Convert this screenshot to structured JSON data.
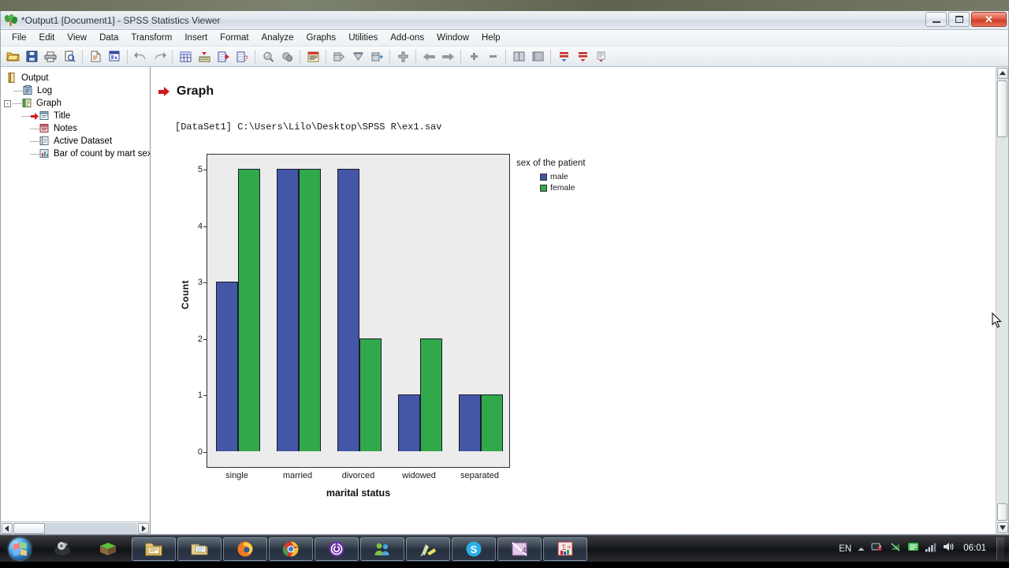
{
  "window": {
    "title": "*Output1 [Document1] - SPSS Statistics Viewer",
    "app_icon": "spss-leaf-icon",
    "minimize_label": "Minimize",
    "maximize_label": "Maximize",
    "close_label": "Close"
  },
  "menubar": {
    "items": [
      {
        "label": "File"
      },
      {
        "label": "Edit"
      },
      {
        "label": "View"
      },
      {
        "label": "Data"
      },
      {
        "label": "Transform"
      },
      {
        "label": "Insert"
      },
      {
        "label": "Format"
      },
      {
        "label": "Analyze"
      },
      {
        "label": "Graphs"
      },
      {
        "label": "Utilities"
      },
      {
        "label": "Add-ons"
      },
      {
        "label": "Window"
      },
      {
        "label": "Help"
      }
    ]
  },
  "toolbar": {
    "buttons": [
      {
        "name": "open-file-icon",
        "tooltip": "Open"
      },
      {
        "name": "save-icon",
        "tooltip": "Save"
      },
      {
        "name": "print-icon",
        "tooltip": "Print"
      },
      {
        "name": "print-preview-icon",
        "tooltip": "Print Preview"
      },
      {
        "name": "new-document-icon",
        "tooltip": "New"
      },
      {
        "name": "export-icon",
        "tooltip": "Export"
      },
      {
        "name": "undo-icon",
        "tooltip": "Undo"
      },
      {
        "name": "redo-icon",
        "tooltip": "Redo"
      },
      {
        "name": "goto-data-icon",
        "tooltip": "Go To Data"
      },
      {
        "name": "variables-icon",
        "tooltip": "Variables"
      },
      {
        "name": "goto-case-icon",
        "tooltip": "Go To Case"
      },
      {
        "name": "run-descriptives-icon",
        "tooltip": "Run Descriptives"
      },
      {
        "name": "find-icon",
        "tooltip": "Find"
      },
      {
        "name": "select-cases-icon",
        "tooltip": "Select Cases"
      },
      {
        "name": "insert-title-icon",
        "tooltip": "Insert Title"
      },
      {
        "name": "split-file-icon",
        "tooltip": "Split File"
      },
      {
        "name": "weight-cases-icon",
        "tooltip": "Weight Cases"
      },
      {
        "name": "value-labels-icon",
        "tooltip": "Value Labels"
      },
      {
        "name": "add-item-icon",
        "tooltip": "Insert"
      },
      {
        "name": "back-arrow-icon",
        "tooltip": "Back"
      },
      {
        "name": "forward-arrow-icon",
        "tooltip": "Forward"
      },
      {
        "name": "expand-icon",
        "tooltip": "Expand"
      },
      {
        "name": "collapse-icon",
        "tooltip": "Collapse"
      },
      {
        "name": "show-book-icon",
        "tooltip": "Show"
      },
      {
        "name": "hide-book-icon",
        "tooltip": "Hide"
      },
      {
        "name": "promote-icon",
        "tooltip": "Promote"
      },
      {
        "name": "demote-icon",
        "tooltip": "Demote"
      },
      {
        "name": "insert-note-icon",
        "tooltip": "Insert Note"
      }
    ]
  },
  "outline": {
    "root": {
      "label": "Output",
      "icon": "output-icon"
    },
    "items": [
      {
        "label": "Log",
        "icon": "log-icon",
        "depth": 1,
        "selected": false,
        "has_marker": false,
        "expander": null
      },
      {
        "label": "Graph",
        "icon": "graph-icon",
        "depth": 1,
        "selected": false,
        "has_marker": false,
        "expander": "-"
      },
      {
        "label": "Title",
        "icon": "title-icon",
        "depth": 2,
        "selected": false,
        "has_marker": true,
        "expander": null
      },
      {
        "label": "Notes",
        "icon": "notes-icon",
        "depth": 2,
        "selected": false,
        "has_marker": false,
        "expander": null
      },
      {
        "label": "Active Dataset",
        "icon": "dataset-icon",
        "depth": 2,
        "selected": false,
        "has_marker": false,
        "expander": null
      },
      {
        "label": "Bar of count by mart sex",
        "icon": "bar-chart-icon",
        "depth": 2,
        "selected": false,
        "has_marker": false,
        "expander": null
      }
    ]
  },
  "output": {
    "heading": "Graph",
    "heading_marker": "red-arrow-icon",
    "dataset_line": "[DataSet1] C:\\Users\\Lilo\\Desktop\\SPSS R\\ex1.sav"
  },
  "colors": {
    "male": "#4457a6",
    "female": "#31a94a",
    "plot_background": "#ececec",
    "plot_border": "#2f2f2f",
    "accent_red": "#d01a1a"
  },
  "chart_data": {
    "type": "bar",
    "title": "",
    "xlabel": "marital status",
    "ylabel": "Count",
    "categories": [
      "single",
      "married",
      "divorced",
      "widowed",
      "separated"
    ],
    "series": [
      {
        "name": "male",
        "color": "#4457a6",
        "values": [
          3,
          5,
          5,
          1,
          1
        ]
      },
      {
        "name": "female",
        "color": "#31a94a",
        "values": [
          5,
          5,
          2,
          2,
          1
        ]
      }
    ],
    "legend_title": "sex of the patient",
    "legend_position": "right",
    "ylim": [
      0,
      5
    ],
    "yticks": [
      0,
      1,
      2,
      3,
      4,
      5
    ],
    "grid": false
  },
  "taskbar": {
    "start_label": "Start",
    "items": [
      {
        "name": "taskbar-item-windows-media",
        "icon": "media-icon",
        "active": false
      },
      {
        "name": "taskbar-item-minecraft",
        "icon": "grass-block-icon",
        "active": false
      },
      {
        "name": "taskbar-item-explorer-folder",
        "icon": "folder-icon",
        "active": true
      },
      {
        "name": "taskbar-item-explorer-window",
        "icon": "window-icon",
        "active": true
      },
      {
        "name": "taskbar-item-firefox",
        "icon": "firefox-icon",
        "active": true
      },
      {
        "name": "taskbar-item-chrome",
        "icon": "chrome-icon",
        "active": true
      },
      {
        "name": "taskbar-item-bittorrent",
        "icon": "bittorrent-icon",
        "active": true
      },
      {
        "name": "taskbar-item-messenger",
        "icon": "messenger-icon",
        "active": true
      },
      {
        "name": "taskbar-item-paint",
        "icon": "paint-icon",
        "active": true
      },
      {
        "name": "taskbar-item-skype",
        "icon": "skype-icon",
        "active": true
      },
      {
        "name": "taskbar-item-media-player",
        "icon": "video-icon",
        "active": true
      },
      {
        "name": "taskbar-item-spss",
        "icon": "spss-icon",
        "active": true
      }
    ],
    "tray": {
      "language": "EN",
      "show_hidden": "chevron-up-icon",
      "icons": [
        "battery-error-icon",
        "network-disconnected-icon",
        "green-shield-icon",
        "signal-icon",
        "volume-icon"
      ],
      "clock_time": "06:01"
    }
  }
}
